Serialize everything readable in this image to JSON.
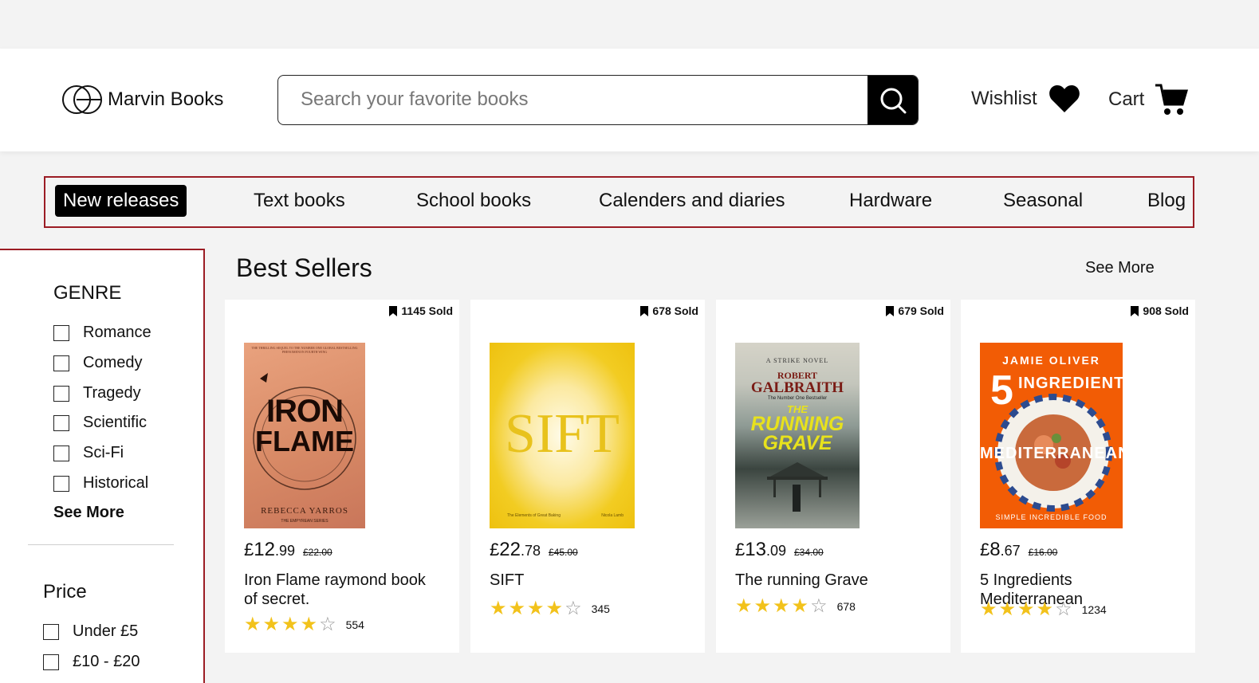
{
  "header": {
    "logo_text": "Marvin Books",
    "search_placeholder": "Search your favorite books",
    "wishlist_label": "Wishlist",
    "cart_label": "Cart"
  },
  "nav": {
    "items": [
      {
        "label": "New releases",
        "active": true
      },
      {
        "label": "Text books"
      },
      {
        "label": "School books"
      },
      {
        "label": "Calenders and diaries"
      },
      {
        "label": "Hardware"
      },
      {
        "label": "Seasonal"
      },
      {
        "label": "Blog"
      }
    ]
  },
  "sidebar": {
    "genre_title": "GENRE",
    "genres": [
      "Romance",
      "Comedy",
      "Tragedy",
      "Scientific",
      "Sci-Fi",
      "Historical"
    ],
    "see_more": "See More",
    "price_title": "Price",
    "prices": [
      "Under £5",
      "£10 - £20"
    ]
  },
  "main": {
    "section_title": "Best Sellers",
    "see_more": "See More",
    "products": [
      {
        "sold": "1145 Sold",
        "currency": "£",
        "price_whole": "12",
        "price_cents": ".99",
        "old_price": "£22.00",
        "title": "Iron Flame raymond book of secret.",
        "rating": 4,
        "rating_count": "554",
        "cover": {
          "top": "THE THRILLING SEQUEL TO THE NUMBER ONE GLOBAL BESTSELLING PHENOMENON FOURTH WING",
          "line1": "IRON",
          "line2": "FLAME",
          "author": "REBECCA YARROS",
          "series": "THE EMPYREAN SERIES"
        }
      },
      {
        "sold": "678 Sold",
        "currency": "£",
        "price_whole": "22",
        "price_cents": ".78",
        "old_price": "£45.00",
        "title": "SIFT",
        "rating": 4,
        "rating_count": "345",
        "cover": {
          "title": "SIFT",
          "bottom_left": "The Elements of Great Baking",
          "bottom_right": "Nicola Lamb"
        }
      },
      {
        "sold": "679 Sold",
        "currency": "£",
        "price_whole": "13",
        "price_cents": ".09",
        "old_price": "£34.00",
        "title": "The running Grave",
        "rating": 4,
        "rating_count": "678",
        "cover": {
          "top": "A STRIKE NOVEL",
          "author1": "ROBERT",
          "author2": "GALBRAITH",
          "tag": "The Number One Bestseller",
          "t1": "THE",
          "t2": "RUNNING",
          "t3": "GRAVE"
        }
      },
      {
        "sold": "908 Sold",
        "currency": "£",
        "price_whole": "8",
        "price_cents": ".67",
        "old_price": "£16.00",
        "title": "5 Ingredients Mediterranean",
        "rating": 4,
        "rating_count": "1234",
        "cover": {
          "author": "JAMIE OLIVER",
          "num": "5",
          "word": "INGREDIENTS",
          "sub": "MEDITERRANEAN",
          "bottom": "SIMPLE INCREDIBLE FOOD"
        }
      }
    ]
  },
  "colors": {
    "accent_border": "#9b1c24",
    "star": "#f2c21b",
    "active_nav_bg": "#000000"
  }
}
